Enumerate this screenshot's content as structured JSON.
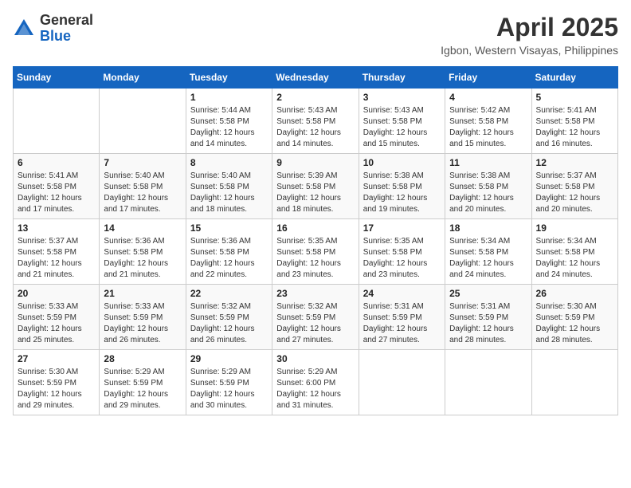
{
  "header": {
    "logo_line1": "General",
    "logo_line2": "Blue",
    "month_year": "April 2025",
    "location": "Igbon, Western Visayas, Philippines"
  },
  "weekdays": [
    "Sunday",
    "Monday",
    "Tuesday",
    "Wednesday",
    "Thursday",
    "Friday",
    "Saturday"
  ],
  "weeks": [
    [
      {
        "day": "",
        "sunrise": "",
        "sunset": "",
        "daylight": ""
      },
      {
        "day": "",
        "sunrise": "",
        "sunset": "",
        "daylight": ""
      },
      {
        "day": "1",
        "sunrise": "Sunrise: 5:44 AM",
        "sunset": "Sunset: 5:58 PM",
        "daylight": "Daylight: 12 hours and 14 minutes."
      },
      {
        "day": "2",
        "sunrise": "Sunrise: 5:43 AM",
        "sunset": "Sunset: 5:58 PM",
        "daylight": "Daylight: 12 hours and 14 minutes."
      },
      {
        "day": "3",
        "sunrise": "Sunrise: 5:43 AM",
        "sunset": "Sunset: 5:58 PM",
        "daylight": "Daylight: 12 hours and 15 minutes."
      },
      {
        "day": "4",
        "sunrise": "Sunrise: 5:42 AM",
        "sunset": "Sunset: 5:58 PM",
        "daylight": "Daylight: 12 hours and 15 minutes."
      },
      {
        "day": "5",
        "sunrise": "Sunrise: 5:41 AM",
        "sunset": "Sunset: 5:58 PM",
        "daylight": "Daylight: 12 hours and 16 minutes."
      }
    ],
    [
      {
        "day": "6",
        "sunrise": "Sunrise: 5:41 AM",
        "sunset": "Sunset: 5:58 PM",
        "daylight": "Daylight: 12 hours and 17 minutes."
      },
      {
        "day": "7",
        "sunrise": "Sunrise: 5:40 AM",
        "sunset": "Sunset: 5:58 PM",
        "daylight": "Daylight: 12 hours and 17 minutes."
      },
      {
        "day": "8",
        "sunrise": "Sunrise: 5:40 AM",
        "sunset": "Sunset: 5:58 PM",
        "daylight": "Daylight: 12 hours and 18 minutes."
      },
      {
        "day": "9",
        "sunrise": "Sunrise: 5:39 AM",
        "sunset": "Sunset: 5:58 PM",
        "daylight": "Daylight: 12 hours and 18 minutes."
      },
      {
        "day": "10",
        "sunrise": "Sunrise: 5:38 AM",
        "sunset": "Sunset: 5:58 PM",
        "daylight": "Daylight: 12 hours and 19 minutes."
      },
      {
        "day": "11",
        "sunrise": "Sunrise: 5:38 AM",
        "sunset": "Sunset: 5:58 PM",
        "daylight": "Daylight: 12 hours and 20 minutes."
      },
      {
        "day": "12",
        "sunrise": "Sunrise: 5:37 AM",
        "sunset": "Sunset: 5:58 PM",
        "daylight": "Daylight: 12 hours and 20 minutes."
      }
    ],
    [
      {
        "day": "13",
        "sunrise": "Sunrise: 5:37 AM",
        "sunset": "Sunset: 5:58 PM",
        "daylight": "Daylight: 12 hours and 21 minutes."
      },
      {
        "day": "14",
        "sunrise": "Sunrise: 5:36 AM",
        "sunset": "Sunset: 5:58 PM",
        "daylight": "Daylight: 12 hours and 21 minutes."
      },
      {
        "day": "15",
        "sunrise": "Sunrise: 5:36 AM",
        "sunset": "Sunset: 5:58 PM",
        "daylight": "Daylight: 12 hours and 22 minutes."
      },
      {
        "day": "16",
        "sunrise": "Sunrise: 5:35 AM",
        "sunset": "Sunset: 5:58 PM",
        "daylight": "Daylight: 12 hours and 23 minutes."
      },
      {
        "day": "17",
        "sunrise": "Sunrise: 5:35 AM",
        "sunset": "Sunset: 5:58 PM",
        "daylight": "Daylight: 12 hours and 23 minutes."
      },
      {
        "day": "18",
        "sunrise": "Sunrise: 5:34 AM",
        "sunset": "Sunset: 5:58 PM",
        "daylight": "Daylight: 12 hours and 24 minutes."
      },
      {
        "day": "19",
        "sunrise": "Sunrise: 5:34 AM",
        "sunset": "Sunset: 5:58 PM",
        "daylight": "Daylight: 12 hours and 24 minutes."
      }
    ],
    [
      {
        "day": "20",
        "sunrise": "Sunrise: 5:33 AM",
        "sunset": "Sunset: 5:59 PM",
        "daylight": "Daylight: 12 hours and 25 minutes."
      },
      {
        "day": "21",
        "sunrise": "Sunrise: 5:33 AM",
        "sunset": "Sunset: 5:59 PM",
        "daylight": "Daylight: 12 hours and 26 minutes."
      },
      {
        "day": "22",
        "sunrise": "Sunrise: 5:32 AM",
        "sunset": "Sunset: 5:59 PM",
        "daylight": "Daylight: 12 hours and 26 minutes."
      },
      {
        "day": "23",
        "sunrise": "Sunrise: 5:32 AM",
        "sunset": "Sunset: 5:59 PM",
        "daylight": "Daylight: 12 hours and 27 minutes."
      },
      {
        "day": "24",
        "sunrise": "Sunrise: 5:31 AM",
        "sunset": "Sunset: 5:59 PM",
        "daylight": "Daylight: 12 hours and 27 minutes."
      },
      {
        "day": "25",
        "sunrise": "Sunrise: 5:31 AM",
        "sunset": "Sunset: 5:59 PM",
        "daylight": "Daylight: 12 hours and 28 minutes."
      },
      {
        "day": "26",
        "sunrise": "Sunrise: 5:30 AM",
        "sunset": "Sunset: 5:59 PM",
        "daylight": "Daylight: 12 hours and 28 minutes."
      }
    ],
    [
      {
        "day": "27",
        "sunrise": "Sunrise: 5:30 AM",
        "sunset": "Sunset: 5:59 PM",
        "daylight": "Daylight: 12 hours and 29 minutes."
      },
      {
        "day": "28",
        "sunrise": "Sunrise: 5:29 AM",
        "sunset": "Sunset: 5:59 PM",
        "daylight": "Daylight: 12 hours and 29 minutes."
      },
      {
        "day": "29",
        "sunrise": "Sunrise: 5:29 AM",
        "sunset": "Sunset: 5:59 PM",
        "daylight": "Daylight: 12 hours and 30 minutes."
      },
      {
        "day": "30",
        "sunrise": "Sunrise: 5:29 AM",
        "sunset": "Sunset: 6:00 PM",
        "daylight": "Daylight: 12 hours and 31 minutes."
      },
      {
        "day": "",
        "sunrise": "",
        "sunset": "",
        "daylight": ""
      },
      {
        "day": "",
        "sunrise": "",
        "sunset": "",
        "daylight": ""
      },
      {
        "day": "",
        "sunrise": "",
        "sunset": "",
        "daylight": ""
      }
    ]
  ]
}
